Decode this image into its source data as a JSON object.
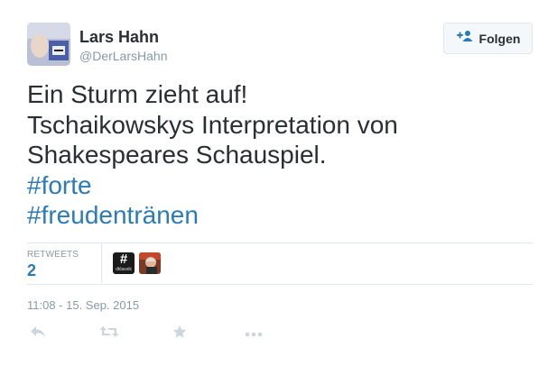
{
  "user": {
    "name": "Lars Hahn",
    "handle": "@DerLarsHahn"
  },
  "follow_button": {
    "label": "Folgen",
    "icon": "add-user-icon"
  },
  "tweet": {
    "lines": [
      "Ein Sturm zieht auf!",
      "Tschaikowskys Interpretation von",
      "Shakespeares Schauspiel."
    ],
    "hashtags": [
      "#forte",
      "#freudentränen"
    ]
  },
  "stats": {
    "retweets_label": "RETWEETS",
    "retweets_count": "2",
    "retweeter_avatars": [
      {
        "name": "hashtag-avatar",
        "symbol": "#",
        "sub": "dklassik"
      },
      {
        "name": "person-avatar"
      }
    ]
  },
  "timestamp": "11:08 - 15. Sep. 2015",
  "actions": [
    "reply-icon",
    "retweet-icon",
    "favorite-icon",
    "more-icon"
  ],
  "colors": {
    "text": "#292f33",
    "muted": "#8899a6",
    "link": "#2b7bb9",
    "border": "#e1e8ed",
    "icon": "#ccd6dd"
  }
}
